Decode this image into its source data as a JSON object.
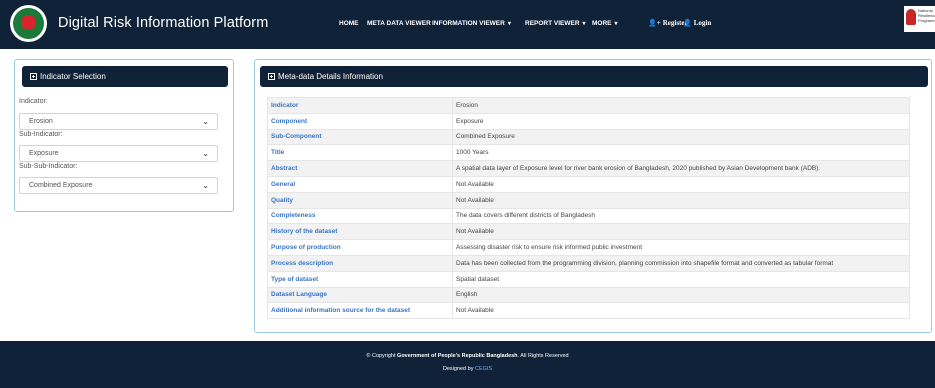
{
  "header": {
    "brand_title": "Digital Risk Information Platform",
    "nav": {
      "home": "HOME",
      "meta_data_viewer": "META DATA VIEWER",
      "information_viewer": "INFORMATION VIEWER",
      "report_viewer": "REPORT VIEWER",
      "more": "MORE"
    },
    "register": "Register",
    "login": "Login",
    "partner_logo_text": [
      "National",
      "Resilience",
      "Programme"
    ]
  },
  "indicator_panel": {
    "title": "Indicator Selection",
    "indicator_label": "Indicator:",
    "indicator_value": "Erosion",
    "sub_indicator_label": "Sub-Indicator:",
    "sub_indicator_value": "Exposure",
    "sub_sub_indicator_label": "Sub-Sub-Indicator:",
    "sub_sub_indicator_value": "Combined Exposure"
  },
  "meta_panel": {
    "title": "Meta-data Details Information",
    "rows": [
      {
        "key": "Indicator",
        "value": "Erosion"
      },
      {
        "key": "Component",
        "value": "Exposure"
      },
      {
        "key": "Sub-Component",
        "value": "Combined Exposure"
      },
      {
        "key": "Title",
        "value": "1000 Years"
      },
      {
        "key": "Abstract",
        "value": "A spatial data layer of Exposure level for river bank erosion of Bangladesh, 2020 published by Asian Development bank (ADB)."
      },
      {
        "key": "General",
        "value": "Not Available"
      },
      {
        "key": "Quality",
        "value": "Not Available"
      },
      {
        "key": "Completeness",
        "value": "The data covers different districts of Bangladesh"
      },
      {
        "key": "History of the dataset",
        "value": "Not Available"
      },
      {
        "key": "Purpose of production",
        "value": "Assessing disaster risk to ensure risk informed public investment"
      },
      {
        "key": "Process description",
        "value": "Data has been collected from the programming division, planning commission into shapefile format and converted as tabular format"
      },
      {
        "key": "Type of dataset",
        "value": "Spatial dataset"
      },
      {
        "key": "Dataset Language",
        "value": "English"
      },
      {
        "key": "Additional information source for the dataset",
        "value": "Not Available"
      }
    ]
  },
  "footer": {
    "copyright_prefix": "© Copyright",
    "organization": "Government of People's Republic Bangladesh",
    "rights": ". All Rights Reserved",
    "designed_by": "Designed by",
    "designer": "CEGIS"
  },
  "icons": {
    "caret": "chevron-down-icon",
    "register_icon": "add-user-icon",
    "login_icon": "user-icon"
  },
  "colors": {
    "header_bg": "#0f2238",
    "key_text": "#3a74c4",
    "panel_border": "#9ccbe0"
  }
}
